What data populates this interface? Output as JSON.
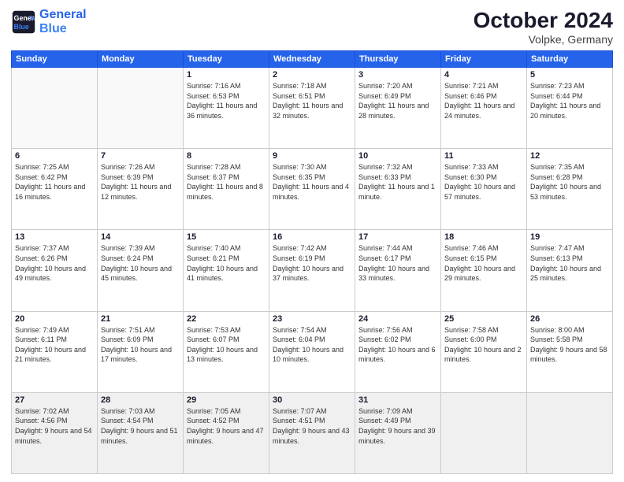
{
  "header": {
    "logo_line1": "General",
    "logo_line2": "Blue",
    "month_title": "October 2024",
    "subtitle": "Volpke, Germany"
  },
  "days_of_week": [
    "Sunday",
    "Monday",
    "Tuesday",
    "Wednesday",
    "Thursday",
    "Friday",
    "Saturday"
  ],
  "weeks": [
    [
      {
        "num": "",
        "detail": ""
      },
      {
        "num": "",
        "detail": ""
      },
      {
        "num": "1",
        "detail": "Sunrise: 7:16 AM\nSunset: 6:53 PM\nDaylight: 11 hours and 36 minutes."
      },
      {
        "num": "2",
        "detail": "Sunrise: 7:18 AM\nSunset: 6:51 PM\nDaylight: 11 hours and 32 minutes."
      },
      {
        "num": "3",
        "detail": "Sunrise: 7:20 AM\nSunset: 6:49 PM\nDaylight: 11 hours and 28 minutes."
      },
      {
        "num": "4",
        "detail": "Sunrise: 7:21 AM\nSunset: 6:46 PM\nDaylight: 11 hours and 24 minutes."
      },
      {
        "num": "5",
        "detail": "Sunrise: 7:23 AM\nSunset: 6:44 PM\nDaylight: 11 hours and 20 minutes."
      }
    ],
    [
      {
        "num": "6",
        "detail": "Sunrise: 7:25 AM\nSunset: 6:42 PM\nDaylight: 11 hours and 16 minutes."
      },
      {
        "num": "7",
        "detail": "Sunrise: 7:26 AM\nSunset: 6:39 PM\nDaylight: 11 hours and 12 minutes."
      },
      {
        "num": "8",
        "detail": "Sunrise: 7:28 AM\nSunset: 6:37 PM\nDaylight: 11 hours and 8 minutes."
      },
      {
        "num": "9",
        "detail": "Sunrise: 7:30 AM\nSunset: 6:35 PM\nDaylight: 11 hours and 4 minutes."
      },
      {
        "num": "10",
        "detail": "Sunrise: 7:32 AM\nSunset: 6:33 PM\nDaylight: 11 hours and 1 minute."
      },
      {
        "num": "11",
        "detail": "Sunrise: 7:33 AM\nSunset: 6:30 PM\nDaylight: 10 hours and 57 minutes."
      },
      {
        "num": "12",
        "detail": "Sunrise: 7:35 AM\nSunset: 6:28 PM\nDaylight: 10 hours and 53 minutes."
      }
    ],
    [
      {
        "num": "13",
        "detail": "Sunrise: 7:37 AM\nSunset: 6:26 PM\nDaylight: 10 hours and 49 minutes."
      },
      {
        "num": "14",
        "detail": "Sunrise: 7:39 AM\nSunset: 6:24 PM\nDaylight: 10 hours and 45 minutes."
      },
      {
        "num": "15",
        "detail": "Sunrise: 7:40 AM\nSunset: 6:21 PM\nDaylight: 10 hours and 41 minutes."
      },
      {
        "num": "16",
        "detail": "Sunrise: 7:42 AM\nSunset: 6:19 PM\nDaylight: 10 hours and 37 minutes."
      },
      {
        "num": "17",
        "detail": "Sunrise: 7:44 AM\nSunset: 6:17 PM\nDaylight: 10 hours and 33 minutes."
      },
      {
        "num": "18",
        "detail": "Sunrise: 7:46 AM\nSunset: 6:15 PM\nDaylight: 10 hours and 29 minutes."
      },
      {
        "num": "19",
        "detail": "Sunrise: 7:47 AM\nSunset: 6:13 PM\nDaylight: 10 hours and 25 minutes."
      }
    ],
    [
      {
        "num": "20",
        "detail": "Sunrise: 7:49 AM\nSunset: 6:11 PM\nDaylight: 10 hours and 21 minutes."
      },
      {
        "num": "21",
        "detail": "Sunrise: 7:51 AM\nSunset: 6:09 PM\nDaylight: 10 hours and 17 minutes."
      },
      {
        "num": "22",
        "detail": "Sunrise: 7:53 AM\nSunset: 6:07 PM\nDaylight: 10 hours and 13 minutes."
      },
      {
        "num": "23",
        "detail": "Sunrise: 7:54 AM\nSunset: 6:04 PM\nDaylight: 10 hours and 10 minutes."
      },
      {
        "num": "24",
        "detail": "Sunrise: 7:56 AM\nSunset: 6:02 PM\nDaylight: 10 hours and 6 minutes."
      },
      {
        "num": "25",
        "detail": "Sunrise: 7:58 AM\nSunset: 6:00 PM\nDaylight: 10 hours and 2 minutes."
      },
      {
        "num": "26",
        "detail": "Sunrise: 8:00 AM\nSunset: 5:58 PM\nDaylight: 9 hours and 58 minutes."
      }
    ],
    [
      {
        "num": "27",
        "detail": "Sunrise: 7:02 AM\nSunset: 4:56 PM\nDaylight: 9 hours and 54 minutes."
      },
      {
        "num": "28",
        "detail": "Sunrise: 7:03 AM\nSunset: 4:54 PM\nDaylight: 9 hours and 51 minutes."
      },
      {
        "num": "29",
        "detail": "Sunrise: 7:05 AM\nSunset: 4:52 PM\nDaylight: 9 hours and 47 minutes."
      },
      {
        "num": "30",
        "detail": "Sunrise: 7:07 AM\nSunset: 4:51 PM\nDaylight: 9 hours and 43 minutes."
      },
      {
        "num": "31",
        "detail": "Sunrise: 7:09 AM\nSunset: 4:49 PM\nDaylight: 9 hours and 39 minutes."
      },
      {
        "num": "",
        "detail": ""
      },
      {
        "num": "",
        "detail": ""
      }
    ]
  ]
}
